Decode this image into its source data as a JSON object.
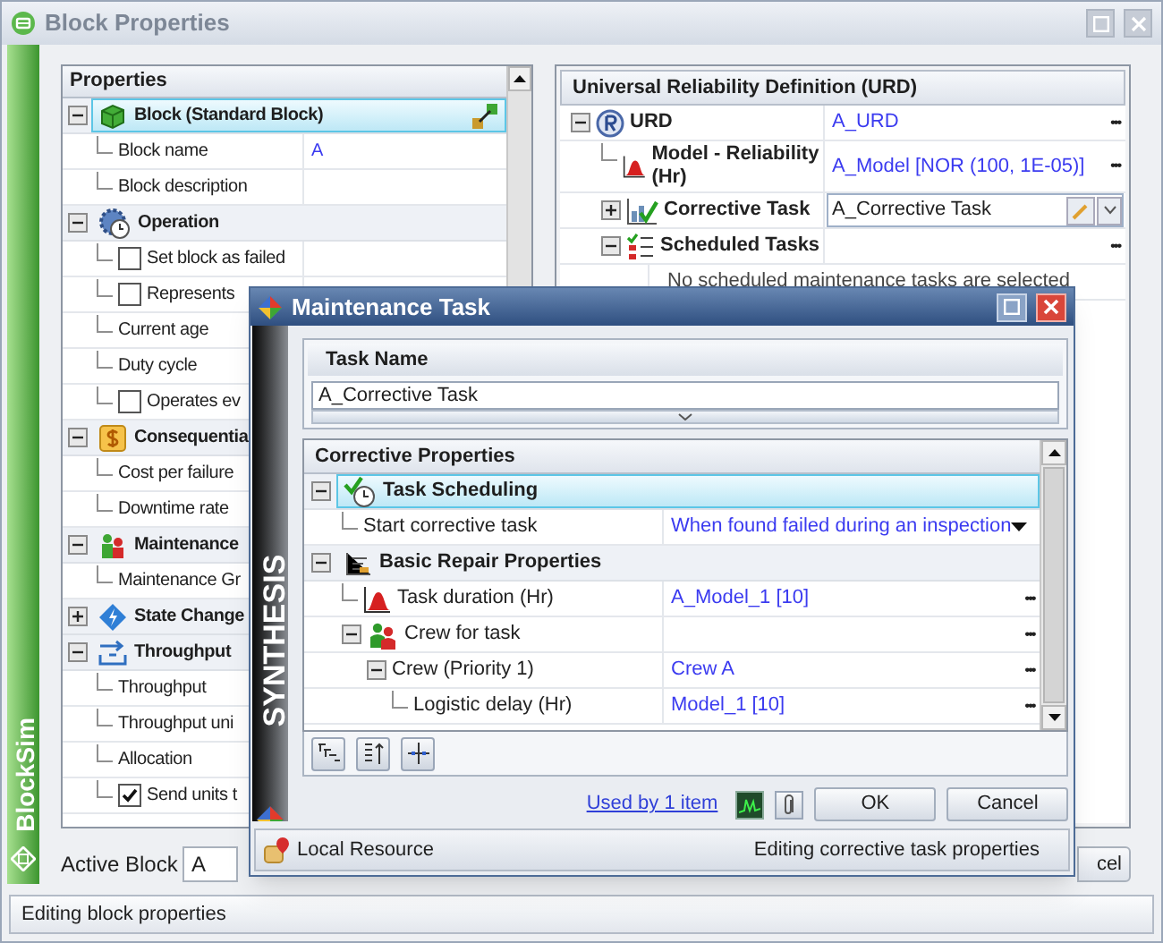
{
  "window": {
    "title": "Block Properties"
  },
  "brand": "BlockSim",
  "properties": {
    "header": "Properties",
    "items": [
      {
        "kind": "section",
        "label": "Block (Standard Block)",
        "selected": true,
        "expanded": true,
        "children": [
          {
            "kind": "text",
            "label": "Block name",
            "value": "A"
          },
          {
            "kind": "text",
            "label": "Block description"
          }
        ]
      },
      {
        "kind": "section",
        "label": "Operation",
        "selected": false,
        "expanded": true,
        "children": [
          {
            "kind": "checkbox",
            "label": "Set block as failed",
            "checked": false
          },
          {
            "kind": "checkbox",
            "label": "Represents",
            "checked": false
          },
          {
            "kind": "text",
            "label": "Current age"
          },
          {
            "kind": "text",
            "label": "Duty cycle"
          },
          {
            "kind": "checkbox",
            "label": "Operates ev",
            "checked": false
          }
        ]
      },
      {
        "kind": "section",
        "label": "Consequentia",
        "selected": false,
        "expanded": true,
        "children": [
          {
            "kind": "text",
            "label": "Cost per failure"
          },
          {
            "kind": "text",
            "label": "Downtime rate"
          }
        ]
      },
      {
        "kind": "section",
        "label": "Maintenance",
        "selected": false,
        "expanded": true,
        "children": [
          {
            "kind": "text",
            "label": "Maintenance Gr"
          }
        ]
      },
      {
        "kind": "section",
        "label": "State Change",
        "selected": false,
        "expanded": false
      },
      {
        "kind": "section",
        "label": "Throughput",
        "selected": false,
        "expanded": true,
        "children": [
          {
            "kind": "text",
            "label": "Throughput"
          },
          {
            "kind": "text",
            "label": "Throughput uni"
          },
          {
            "kind": "text",
            "label": "Allocation"
          },
          {
            "kind": "checkbox",
            "label": "Send units t",
            "checked": true
          }
        ]
      }
    ]
  },
  "urd": {
    "header": "Universal Reliability Definition (URD)",
    "items": [
      {
        "kind": "text",
        "label": "URD",
        "value": "A_URD",
        "action": "•••",
        "expanded": true,
        "children": [
          {
            "kind": "text",
            "label": "Model - Reliability (Hr)",
            "value": "A_Model [NOR (100, 1E-05)]",
            "action": "•••"
          },
          {
            "kind": "editor",
            "label": "Corrective Task",
            "value": "A_Corrective Task",
            "expanded": false
          },
          {
            "kind": "text",
            "label": "Scheduled Tasks",
            "action": "•••",
            "expanded": true,
            "children": [
              {
                "kind": "message",
                "label": "No scheduled maintenance tasks are selected"
              }
            ]
          }
        ]
      }
    ]
  },
  "active_block": {
    "label": "Active Block",
    "value": "A"
  },
  "cancel_button": "cel",
  "status": "Editing block properties",
  "dialog": {
    "title": "Maintenance Task",
    "brand": "SYNTHESIS",
    "task_name": {
      "header": "Task Name",
      "value": "A_Corrective Task"
    },
    "corrective": {
      "header": "Corrective Properties",
      "items": [
        {
          "kind": "section",
          "label": "Task Scheduling",
          "selected": true,
          "expanded": true,
          "children": [
            {
              "kind": "dropdown",
              "label": "Start corrective task",
              "value": "When found failed during an inspection"
            }
          ]
        },
        {
          "kind": "section",
          "label": "Basic Repair Properties",
          "selected": false,
          "expanded": true,
          "children": [
            {
              "kind": "text",
              "label": "Task duration (Hr)",
              "value": "A_Model_1 [10]",
              "action": "•••"
            },
            {
              "kind": "text",
              "label": "Crew for task",
              "action": "•••",
              "expanded": true,
              "children": [
                {
                  "kind": "text",
                  "label": "Crew (Priority 1)",
                  "value": "Crew A",
                  "action": "•••",
                  "expanded": true,
                  "children": [
                    {
                      "kind": "text",
                      "label": "Logistic delay (Hr)",
                      "value": "Model_1 [10]",
                      "action": "•••"
                    }
                  ]
                }
              ]
            }
          ]
        }
      ]
    },
    "link": "Used by 1 item",
    "buttons": [
      "OK",
      "Cancel"
    ],
    "status_left": "Local Resource",
    "status_right": "Editing corrective task properties"
  }
}
